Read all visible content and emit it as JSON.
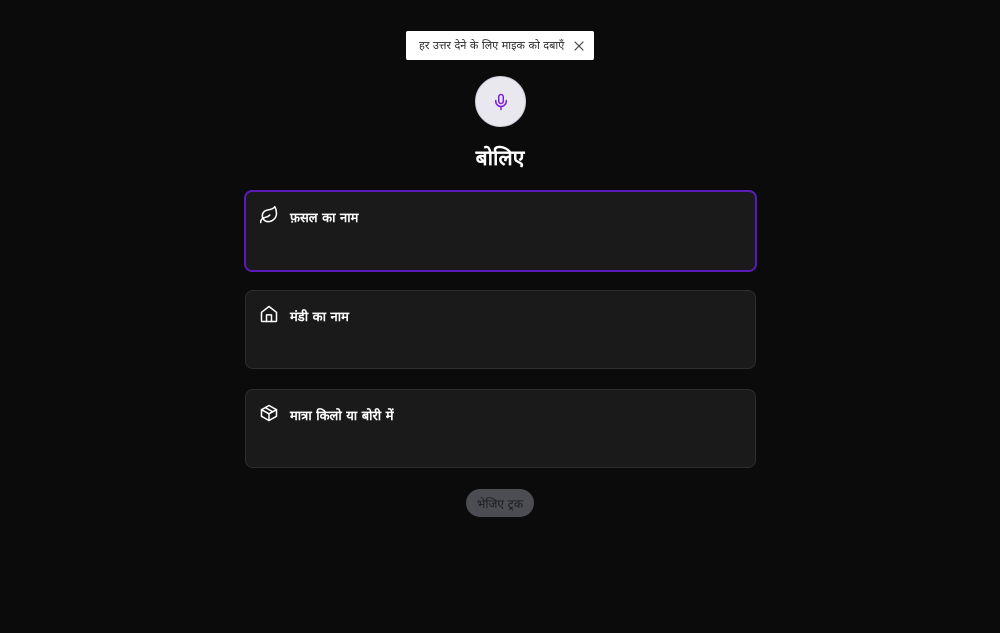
{
  "tooltip": {
    "text": "हर उत्तर देने के लिए माइक को दबाएँ",
    "close_icon": "close-icon"
  },
  "mic": {
    "icon": "microphone-icon",
    "accent_color": "#7c1fe0"
  },
  "prompt": {
    "title": "बोलिए"
  },
  "fields": [
    {
      "label": "फ़सल का नाम",
      "icon": "leaf-icon",
      "value": "",
      "active": true
    },
    {
      "label": "मंडी का नाम",
      "icon": "home-icon",
      "value": "",
      "active": false
    },
    {
      "label": "मात्रा किलो या बोरी में",
      "icon": "package-icon",
      "value": "",
      "active": false
    }
  ],
  "submit": {
    "label": "भेजिए ट्रक",
    "enabled": false
  },
  "colors": {
    "background": "#0b0b0c",
    "card": "#1a1a1b",
    "active_border": "#5b1ab8",
    "button_disabled": "#4b4d52"
  }
}
